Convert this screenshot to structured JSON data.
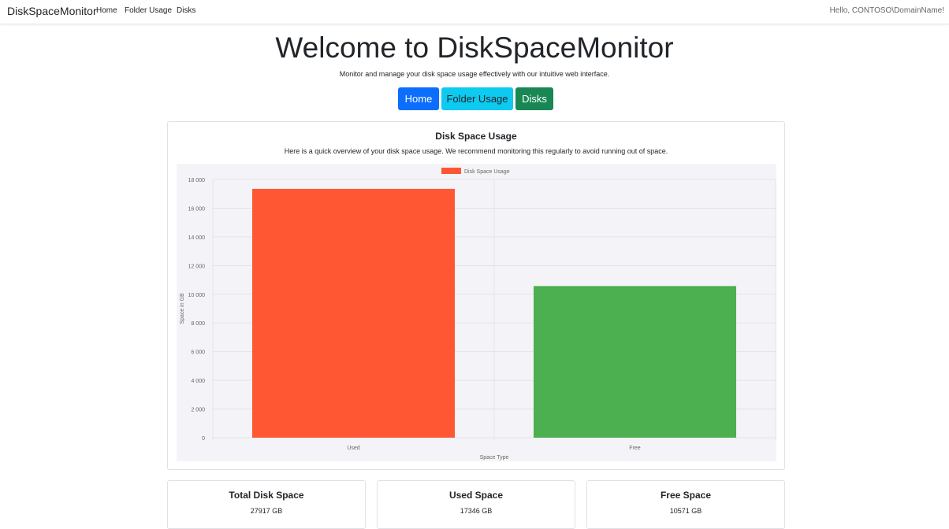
{
  "nav": {
    "brand": "DiskSpaceMonitor",
    "links": [
      "Home",
      "Folder Usage",
      "Disks"
    ],
    "user_greeting": "Hello, CONTOSO\\DomainName!"
  },
  "hero": {
    "title": "Welcome to DiskSpaceMonitor",
    "subtitle": "Monitor and manage your disk space usage effectively with our intuitive web interface.",
    "buttons": [
      "Home",
      "Folder Usage",
      "Disks"
    ]
  },
  "card": {
    "title": "Disk Space Usage",
    "text": "Here is a quick overview of your disk space usage. We recommend monitoring this regularly to avoid running out of space."
  },
  "chart_data": {
    "type": "bar",
    "categories": [
      "Used",
      "Free"
    ],
    "series": [
      {
        "name": "Disk Space Usage",
        "values": [
          17346,
          10571
        ]
      }
    ],
    "bar_colors": [
      "#ff5733",
      "#4caf50"
    ],
    "xlabel": "Space Type",
    "ylabel": "Space in GB",
    "ylim": [
      0,
      18000
    ],
    "yticks": [
      0,
      2000,
      4000,
      6000,
      8000,
      10000,
      12000,
      14000,
      16000,
      18000
    ],
    "ytick_labels": [
      "0",
      "2 000",
      "4 000",
      "6 000",
      "8 000",
      "10 000",
      "12 000",
      "14 000",
      "16 000",
      "18 000"
    ],
    "legend_position": "top",
    "grid": true
  },
  "stats": [
    {
      "title": "Total Disk Space",
      "value": "27917 GB"
    },
    {
      "title": "Used Space",
      "value": "17346 GB"
    },
    {
      "title": "Free Space",
      "value": "10571 GB"
    }
  ],
  "colors": {
    "primary": "#0d6efd",
    "info": "#0dcaf0",
    "success": "#198754",
    "chart_bg": "#f4f4f8"
  }
}
